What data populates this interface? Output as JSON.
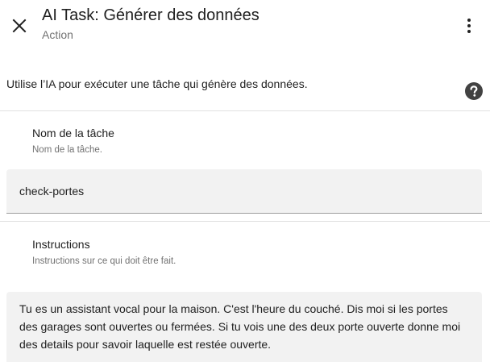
{
  "header": {
    "title": "AI Task: Générer des données",
    "subtitle": "Action"
  },
  "description": "Utilise l’IA pour exécuter une tâche qui génère des données.",
  "task_name": {
    "label": "Nom de la tâche",
    "help": "Nom de la tâche.",
    "value": "check-portes"
  },
  "instructions": {
    "label": "Instructions",
    "help": "Instructions sur ce qui doit être fait.",
    "value": "Tu es un assistant vocal pour la maison. C'est l'heure du couché. Dis moi si les portes des garages sont ouvertes ou fermées. Si tu vois une des deux porte ouverte donne moi des details pour savoir laquelle est restée ouverte."
  },
  "icons": {
    "close": "close-icon",
    "more": "more-vert-icon",
    "help": "help-circle-icon"
  }
}
